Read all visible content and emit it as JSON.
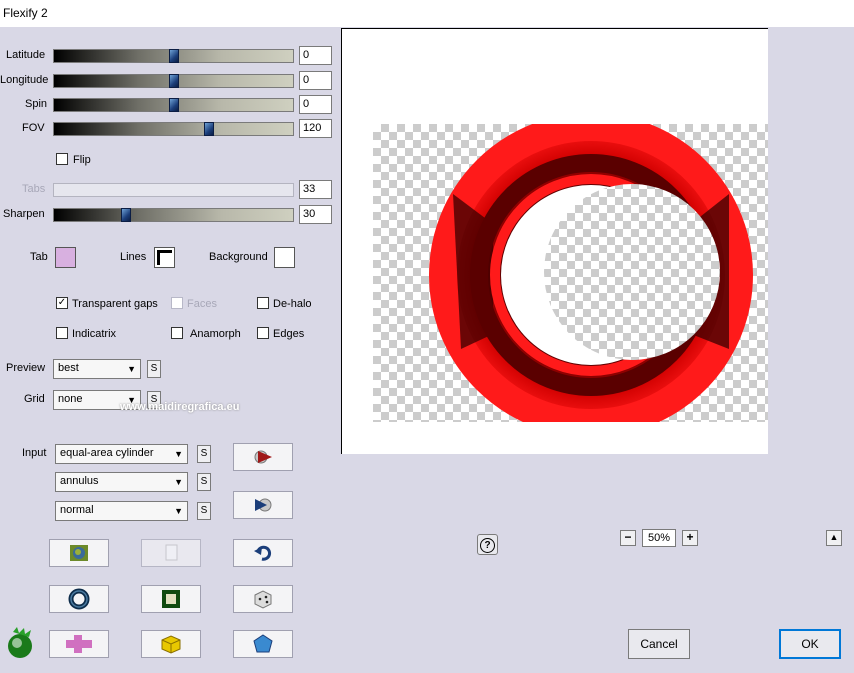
{
  "window": {
    "title": "Flexify 2"
  },
  "sliders": [
    {
      "label": "Latitude",
      "value": "0",
      "fraction": 0.5,
      "disabled": false
    },
    {
      "label": "Longitude",
      "value": "0",
      "fraction": 0.5,
      "disabled": false
    },
    {
      "label": "Spin",
      "value": "0",
      "fraction": 0.5,
      "disabled": false
    },
    {
      "label": "FOV",
      "value": "120",
      "fraction": 0.65,
      "disabled": false
    },
    {
      "label": "Tabs",
      "value": "33",
      "fraction": null,
      "disabled": true
    },
    {
      "label": "Sharpen",
      "value": "30",
      "fraction": 0.3,
      "disabled": false
    }
  ],
  "checkboxes": {
    "flip": {
      "label": "Flip",
      "checked": false,
      "disabled": false
    },
    "transparent_gaps": {
      "label": "Transparent gaps",
      "checked": true,
      "disabled": false
    },
    "faces": {
      "label": "Faces",
      "checked": false,
      "disabled": true
    },
    "dehalo": {
      "label": "De-halo",
      "checked": false,
      "disabled": false
    },
    "indicatrix": {
      "label": "Indicatrix",
      "checked": false,
      "disabled": false
    },
    "anamorph": {
      "label": "Anamorph",
      "checked": false,
      "disabled": false
    },
    "edges": {
      "label": "Edges",
      "checked": false,
      "disabled": false
    }
  },
  "colors": {
    "tab_label": "Tab",
    "tab_color": "#d8b0e0",
    "lines_label": "Lines",
    "lines_color": "#000000",
    "background_label": "Background",
    "background_color": "#ffffff"
  },
  "preview": {
    "label": "Preview",
    "value": "best"
  },
  "grid": {
    "label": "Grid",
    "value": "none"
  },
  "input": {
    "label": "Input",
    "value": "equal-area cylinder"
  },
  "output": {
    "value": "annulus"
  },
  "mode": {
    "value": "normal"
  },
  "small_button_label": "S",
  "watermark": "www.maidiregrafica.eu",
  "zoom": {
    "minus": "−",
    "value": "50%",
    "plus": "+"
  },
  "help_label": "?",
  "cancel_label": "Cancel",
  "ok_label": "OK",
  "accent": "#1b3e7a"
}
